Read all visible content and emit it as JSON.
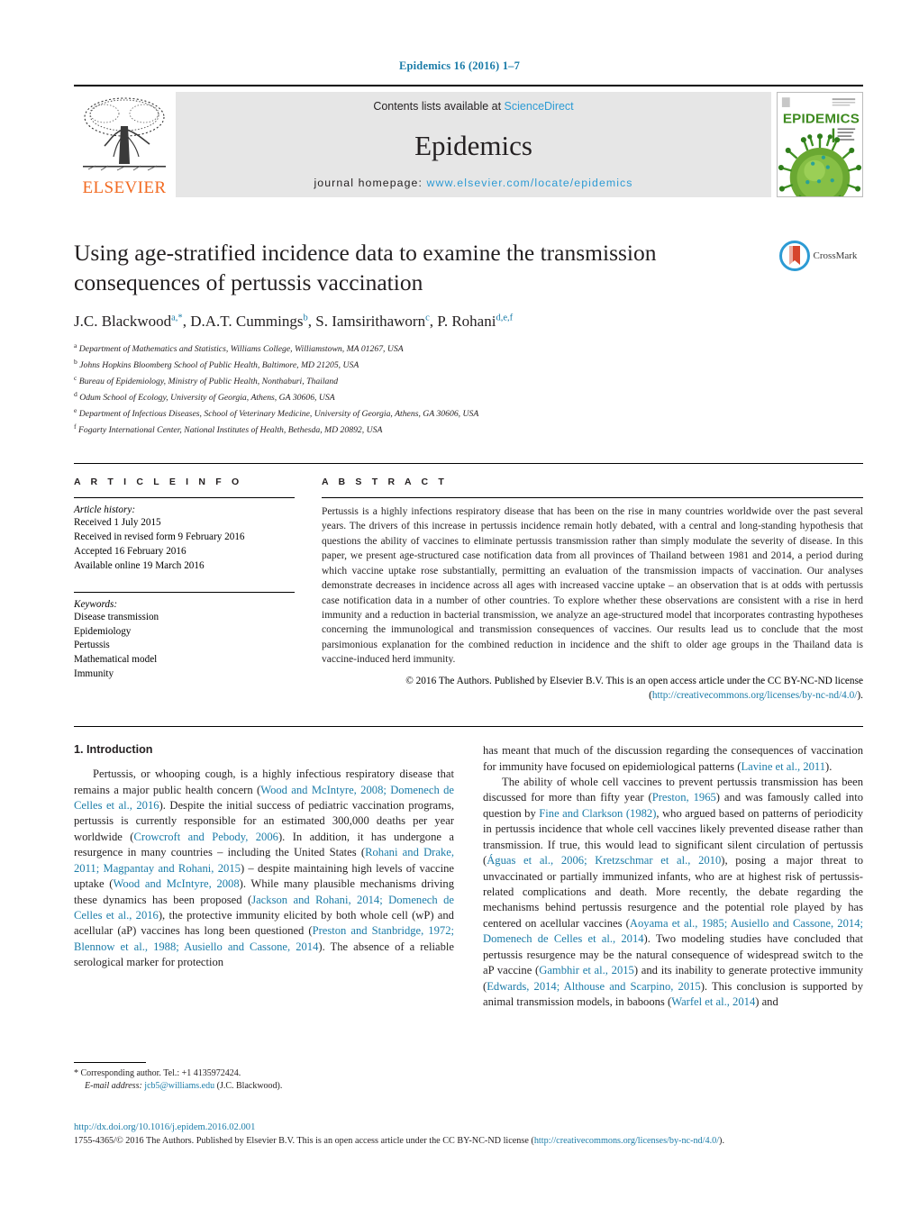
{
  "running_head": "Epidemics 16 (2016) 1–7",
  "journal_header": {
    "publisher_name": "ELSEVIER",
    "contents_prefix": "Contents lists available at ",
    "contents_link": "ScienceDirect",
    "journal_name": "Epidemics",
    "homepage_prefix": "journal homepage: ",
    "homepage_url": "www.elsevier.com/locate/epidemics",
    "cover_title": "EPIDEMICS"
  },
  "crossmark": {
    "label": "CrossMark"
  },
  "article": {
    "title": "Using age-stratified incidence data to examine the transmission consequences of pertussis vaccination",
    "authors": [
      {
        "name": "J.C. Blackwood",
        "marks": "a,*"
      },
      {
        "name": "D.A.T. Cummings",
        "marks": "b"
      },
      {
        "name": "S. Iamsirithaworn",
        "marks": "c"
      },
      {
        "name": "P. Rohani",
        "marks": "d,e,f"
      }
    ],
    "affiliations": [
      {
        "mark": "a",
        "text": "Department of Mathematics and Statistics, Williams College, Williamstown, MA 01267, USA"
      },
      {
        "mark": "b",
        "text": "Johns Hopkins Bloomberg School of Public Health, Baltimore, MD 21205, USA"
      },
      {
        "mark": "c",
        "text": "Bureau of Epidemiology, Ministry of Public Health, Nonthaburi, Thailand"
      },
      {
        "mark": "d",
        "text": "Odum School of Ecology, University of Georgia, Athens, GA 30606, USA"
      },
      {
        "mark": "e",
        "text": "Department of Infectious Diseases, School of Veterinary Medicine, University of Georgia, Athens, GA 30606, USA"
      },
      {
        "mark": "f",
        "text": "Fogarty International Center, National Institutes of Health, Bethesda, MD 20892, USA"
      }
    ]
  },
  "article_info": {
    "heading": "A R T I C L E   I N F O",
    "history_label": "Article history:",
    "history": [
      "Received 1 July 2015",
      "Received in revised form 9 February 2016",
      "Accepted 16 February 2016",
      "Available online 19 March 2016"
    ],
    "keywords_label": "Keywords:",
    "keywords": [
      "Disease transmission",
      "Epidemiology",
      "Pertussis",
      "Mathematical model",
      "Immunity"
    ]
  },
  "abstract": {
    "heading": "A B S T R A C T",
    "body": "Pertussis is a highly infections respiratory disease that has been on the rise in many countries worldwide over the past several years. The drivers of this increase in pertussis incidence remain hotly debated, with a central and long-standing hypothesis that questions the ability of vaccines to eliminate pertussis transmission rather than simply modulate the severity of disease. In this paper, we present age-structured case notification data from all provinces of Thailand between 1981 and 2014, a period during which vaccine uptake rose substantially, permitting an evaluation of the transmission impacts of vaccination. Our analyses demonstrate decreases in incidence across all ages with increased vaccine uptake – an observation that is at odds with pertussis case notification data in a number of other countries. To explore whether these observations are consistent with a rise in herd immunity and a reduction in bacterial transmission, we analyze an age-structured model that incorporates contrasting hypotheses concerning the immunological and transmission consequences of vaccines. Our results lead us to conclude that the most parsimonious explanation for the combined reduction in incidence and the shift to older age groups in the Thailand data is vaccine-induced herd immunity.",
    "copyright_text": "© 2016 The Authors. Published by Elsevier B.V. This is an open access article under the CC BY-NC-ND license (",
    "copyright_link": "http://creativecommons.org/licenses/by-nc-nd/4.0/",
    "copyright_tail": ")."
  },
  "introduction": {
    "number_title": "1.  Introduction",
    "left_paragraph_1_parts": [
      {
        "t": "Pertussis, or whooping cough, is a highly infectious respiratory disease that remains a major public health concern (",
        "link": false
      },
      {
        "t": "Wood and McIntyre, 2008; Domenech de Celles et al., 2016",
        "link": true
      },
      {
        "t": "). Despite the initial success of pediatric vaccination programs, pertussis is currently responsible for an estimated 300,000 deaths per year worldwide (",
        "link": false
      },
      {
        "t": "Crowcroft and Pebody, 2006",
        "link": true
      },
      {
        "t": "). In addition, it has undergone a resurgence in many countries – including the United States (",
        "link": false
      },
      {
        "t": "Rohani and Drake, 2011; Magpantay and Rohani, 2015",
        "link": true
      },
      {
        "t": ") – despite maintaining high levels of vaccine uptake (",
        "link": false
      },
      {
        "t": "Wood and McIntyre, 2008",
        "link": true
      },
      {
        "t": "). While many plausible mechanisms driving these dynamics has been proposed (",
        "link": false
      },
      {
        "t": "Jackson and Rohani, 2014; Domenech de Celles et al., 2016",
        "link": true
      },
      {
        "t": "), the protective immunity elicited by both whole cell (wP) and acellular (aP) vaccines has long been questioned (",
        "link": false
      },
      {
        "t": "Preston and Stanbridge, 1972; Blennow et al., 1988; Ausiello and Cassone, 2014",
        "link": true
      },
      {
        "t": "). The absence of a reliable serological marker for protection",
        "link": false
      }
    ],
    "right_paragraph_1_parts": [
      {
        "t": "has meant that much of the discussion regarding the consequences of vaccination for immunity have focused on epidemiological patterns (",
        "link": false
      },
      {
        "t": "Lavine et al., 2011",
        "link": true
      },
      {
        "t": ").",
        "link": false
      }
    ],
    "right_paragraph_2_parts": [
      {
        "t": "The ability of whole cell vaccines to prevent pertussis transmission has been discussed for more than fifty year (",
        "link": false
      },
      {
        "t": "Preston, 1965",
        "link": true
      },
      {
        "t": ") and was famously called into question by ",
        "link": false
      },
      {
        "t": "Fine and Clarkson (1982)",
        "link": true
      },
      {
        "t": ", who argued based on patterns of periodicity in pertussis incidence that whole cell vaccines likely prevented disease rather than transmission. If true, this would lead to significant silent circulation of pertussis (",
        "link": false
      },
      {
        "t": "Águas et al., 2006; Kretzschmar et al., 2010",
        "link": true
      },
      {
        "t": "), posing a major threat to unvaccinated or partially immunized infants, who are at highest risk of pertussis-related complications and death. More recently, the debate regarding the mechanisms behind pertussis resurgence and the potential role played by has centered on acellular vaccines (",
        "link": false
      },
      {
        "t": "Aoyama et al., 1985; Ausiello and Cassone, 2014; Domenech de Celles et al., 2014",
        "link": true
      },
      {
        "t": "). Two modeling studies have concluded that pertussis resurgence may be the natural consequence of widespread switch to the aP vaccine (",
        "link": false
      },
      {
        "t": "Gambhir et al., 2015",
        "link": true
      },
      {
        "t": ") and its inability to generate protective immunity (",
        "link": false
      },
      {
        "t": "Edwards, 2014; Althouse and Scarpino, 2015",
        "link": true
      },
      {
        "t": "). This conclusion is supported by animal transmission models, in baboons (",
        "link": false
      },
      {
        "t": "Warfel et al., 2014",
        "link": true
      },
      {
        "t": ") and",
        "link": false
      }
    ]
  },
  "footnote": {
    "star": "*",
    "corresponding": "Corresponding author. Tel.: +1 4135972424.",
    "email_label": "E-mail address:",
    "email": "jcb5@williams.edu",
    "email_owner": "(J.C. Blackwood)."
  },
  "page_footer": {
    "doi": "http://dx.doi.org/10.1016/j.epidem.2016.02.001",
    "issn_copyright_pre": "1755-4365/© 2016 The Authors. Published by Elsevier B.V. This is an open access article under the CC BY-NC-ND license (",
    "license_url": "http://creativecommons.org/licenses/by-nc-nd/4.0/",
    "issn_copyright_post": ")."
  },
  "colors": {
    "link_blue": "#1b7ca8",
    "sciencedirect_blue": "#2d9bd4",
    "elsevier_orange": "#f26a21",
    "header_band_gray": "#e6e6e6",
    "cover_green": "#6aa832",
    "crossmark_red": "#d6452c"
  }
}
